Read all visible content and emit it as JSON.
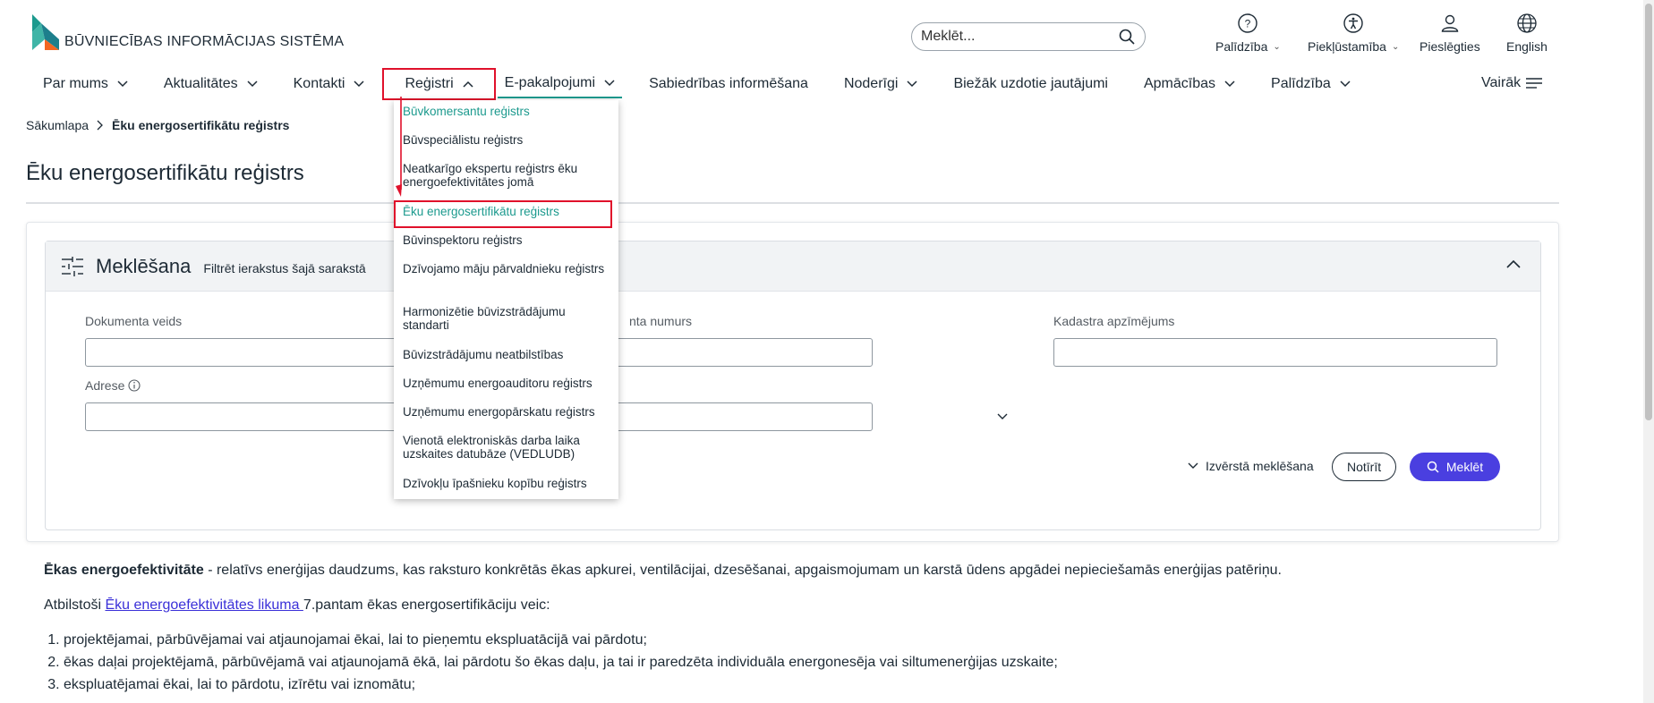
{
  "header": {
    "logo_text": "BŪVNIECĪBAS INFORMĀCIJAS SISTĒMA",
    "search_placeholder": "Meklēt...",
    "utilities": [
      {
        "label": "Palīdzība",
        "icon": "help-circle-icon"
      },
      {
        "label": "Piekļūstamība",
        "icon": "accessibility-icon"
      },
      {
        "label": "Pieslēgties",
        "icon": "user-icon"
      },
      {
        "label": "English",
        "icon": "globe-icon"
      }
    ]
  },
  "nav": {
    "items": [
      "Par mums",
      "Aktualitātes",
      "Kontakti",
      "Reģistri",
      "E-pakalpojumi",
      "Sabiedrības informēšana",
      "Noderīgi",
      "Biežāk uzdotie jautājumi",
      "Apmācības",
      "Palīdzība"
    ],
    "more": "Vairāk"
  },
  "dropdown": {
    "items": [
      "Būvkomersantu reģistrs",
      "Būvspeciālistu reģistrs",
      "Neatkarīgo ekspertu reģistrs ēku energoefektivitātes jomā",
      "Ēku energosertifikātu reģistrs",
      "Būvinspektoru reģistrs",
      "Dzīvojamo māju pārvaldnieku reģistrs",
      "Harmonizētie būvizstrādājumu standarti",
      "Būvizstrādājumu neatbilstības",
      "Uzņēmumu energoauditoru reģistrs",
      "Uzņēmumu energopārskatu reģistrs",
      "Vienotā elektroniskās darba laika uzskaites datubāze (VEDLUDB)",
      "Dzīvokļu īpašnieku kopību reģistrs"
    ]
  },
  "breadcrumb": {
    "home": "Sākumlapa",
    "current": "Ēku energosertifikātu reģistrs"
  },
  "page": {
    "title": "Ēku energosertifikātu reģistrs"
  },
  "search_panel": {
    "title": "Meklēšana",
    "subtitle": "Filtrēt ierakstus šajā sarakstā",
    "fields": {
      "doc_type": "Dokumenta veids",
      "doc_number": "nta numurs",
      "cadastre": "Kadastra apzīmējums",
      "address": "Adrese"
    },
    "advanced": "Izvērstā meklēšana",
    "clear": "Notīrīt",
    "search": "Meklēt"
  },
  "content": {
    "p1_bold": "Ēkas energoefektivitāte",
    "p1_rest": " - relatīvs enerģijas daudzums, kas raksturo konkrētās ēkas apkurei, ventilācijai, dzesēšanai, apgaismojumam un karstā ūdens apgādei nepieciešamās enerģijas patēriņu.",
    "p2_pre": "Atbilstoši ",
    "p2_link": "Ēku energoefektivitātes likuma ",
    "p2_post": "7.pantam ēkas energosertifikāciju veic:",
    "list": [
      "projektējamai, pārbūvējamai vai atjaunojamai ēkai, lai to pieņemtu ekspluatācijā vai pārdotu;",
      "ēkas daļai projektējamā, pārbūvējamā vai atjaunojamā ēkā, lai pārdotu šo ēkas daļu, ja tai ir paredzēta individuāla energonesēja vai siltumenerģijas uzskaite;",
      "ekspluatējamai ēkai, lai to pārdotu, izīrētu vai iznomātu;"
    ]
  }
}
